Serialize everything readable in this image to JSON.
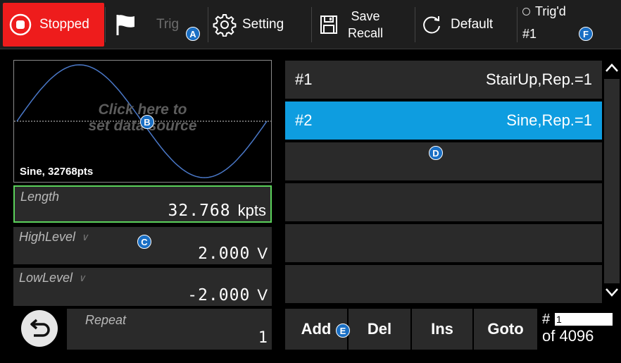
{
  "toolbar": {
    "stopped_label": "Stopped",
    "trig_label": "Trig",
    "setting_label": "Setting",
    "save_line1": "Save",
    "save_line2": "Recall",
    "default_label": "Default",
    "trigd_label": "Trig'd",
    "trigd_channel": "#1"
  },
  "waveform": {
    "hint_line1": "Click here to",
    "hint_line2": "set data source",
    "info": "Sine, 32768pts"
  },
  "params": {
    "length": {
      "label": "Length",
      "value": "32.768",
      "unit": "kpts"
    },
    "high_level": {
      "label": "HighLevel",
      "value": "2.000",
      "unit": "V"
    },
    "low_level": {
      "label": "LowLevel",
      "value": "-2.000",
      "unit": "V"
    },
    "repeat": {
      "label": "Repeat",
      "value": "1"
    }
  },
  "segments": [
    {
      "index": "#1",
      "desc": "StairUp,Rep.=1"
    },
    {
      "index": "#2",
      "desc": "Sine,Rep.=1"
    },
    {
      "index": "",
      "desc": ""
    },
    {
      "index": "",
      "desc": ""
    },
    {
      "index": "",
      "desc": ""
    },
    {
      "index": "",
      "desc": ""
    }
  ],
  "selected_segment": 1,
  "actions": {
    "add": "Add",
    "del": "Del",
    "ins": "Ins",
    "goto": "Goto"
  },
  "pager": {
    "hash": "#",
    "current": "1",
    "of_total": "of 4096"
  },
  "badges": {
    "a": "A",
    "b": "B",
    "c": "C",
    "d": "D",
    "e": "E",
    "f": "F"
  },
  "colors": {
    "stopped_bg": "#ee1c1c",
    "selected_row": "#0e9de0",
    "active_field_border": "#5bd15b",
    "badge": "#1a6fc4",
    "waveform": "#4a78c8"
  }
}
